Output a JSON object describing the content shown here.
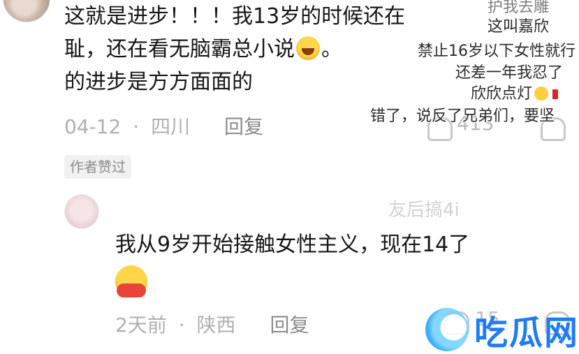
{
  "comment": {
    "line1": "这就是进步！！！我13岁的时候还在",
    "line2a": "耻，还在看无脑霸总小说",
    "line2b": "。",
    "line3": "的进步是方方面面的",
    "emoji_icon": "face-with-tears-of-joy",
    "date": "04-12",
    "separator": "·",
    "location": "四川",
    "reply_label": "回复",
    "likes": "413",
    "badge": "作者赞过"
  },
  "reply": {
    "username": "友后搞4i",
    "text": "我从9岁开始接触女性主义，现在14了",
    "emoji_icon": "hugging-face",
    "date": "2天前",
    "separator": "·",
    "location": "陕西",
    "reply_label": "回复",
    "likes": "15"
  },
  "danmaku": [
    {
      "text": "护我去雕"
    },
    {
      "text": "这叫嘉欣"
    },
    {
      "text": "禁止16岁以下女性就行"
    },
    {
      "text": "还差一年我忍了"
    },
    {
      "text": "欣欣点灯"
    },
    {
      "text": "错了，说反了兄弟们，要坚"
    }
  ],
  "watermark": {
    "text": "吃瓜网",
    "icon": "watermelon-logo-icon"
  }
}
